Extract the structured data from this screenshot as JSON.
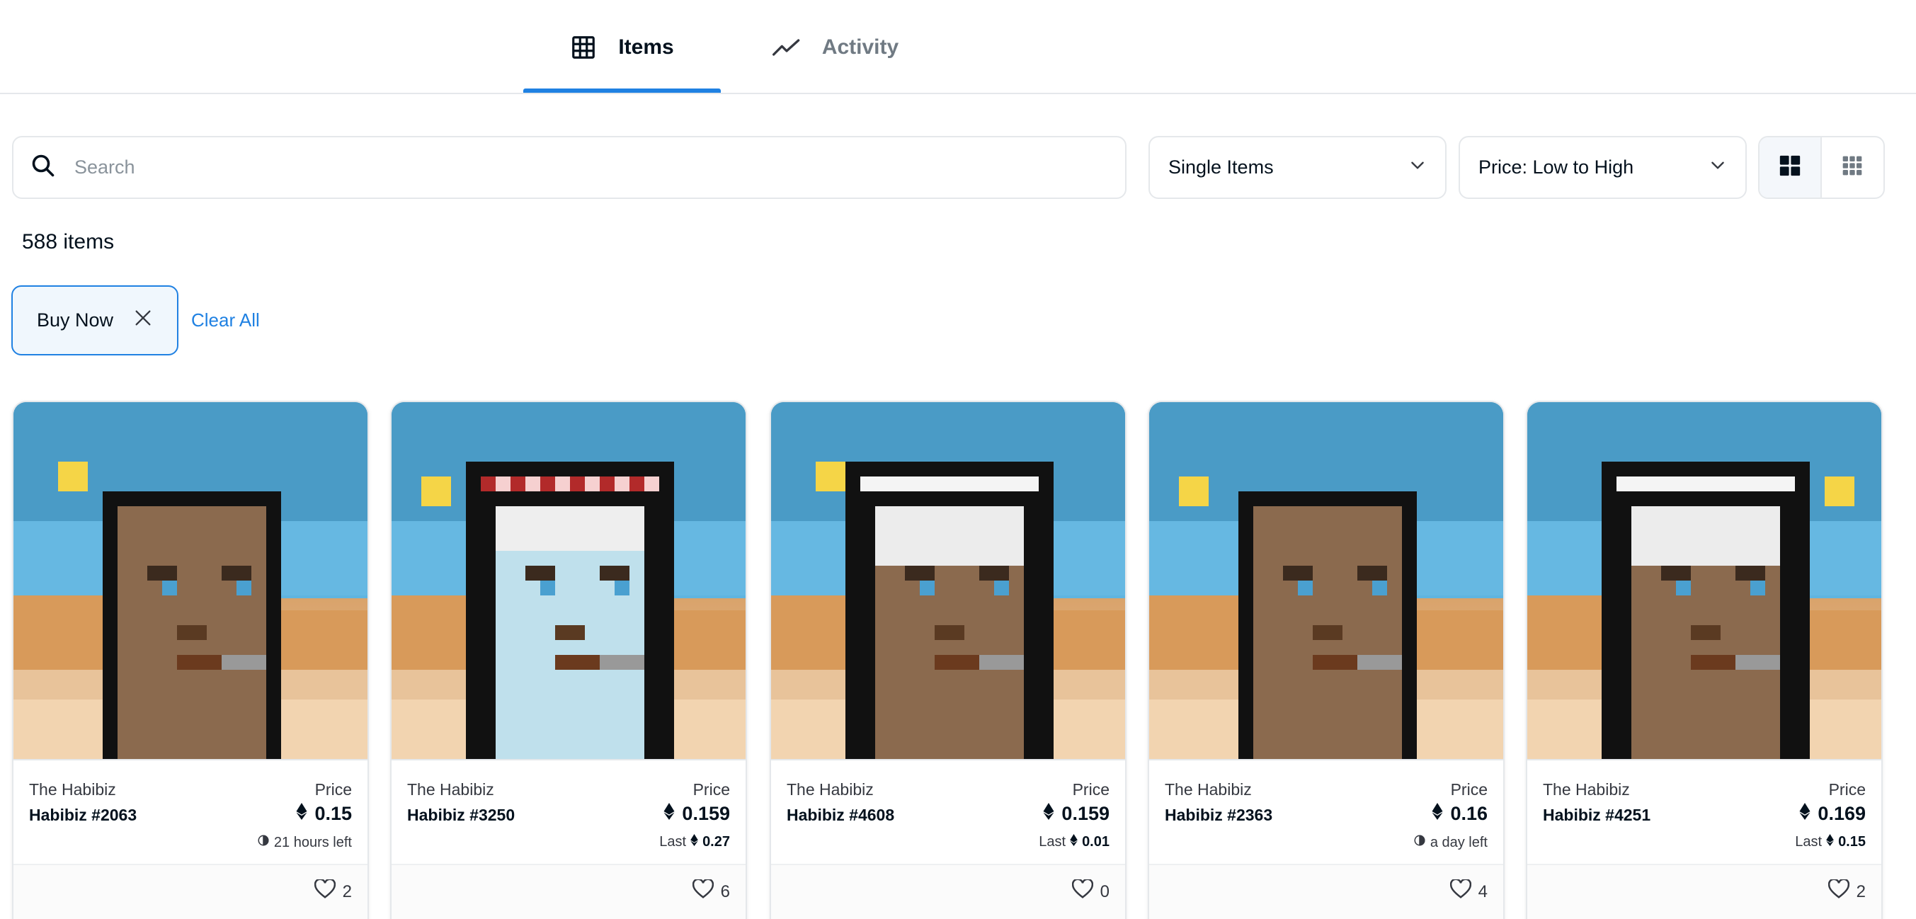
{
  "tabs": [
    {
      "label": "Items",
      "icon": "grid-icon",
      "active": true
    },
    {
      "label": "Activity",
      "icon": "activity-icon",
      "active": false
    }
  ],
  "search": {
    "placeholder": "Search",
    "value": ""
  },
  "filters": {
    "sale_type": "Single Items",
    "sort": "Price: Low to High"
  },
  "view_toggle": {
    "options": [
      "large-grid",
      "small-grid"
    ],
    "selected": "large-grid"
  },
  "results": {
    "count_label": "588 items"
  },
  "active_filters": {
    "chips": [
      "Buy Now"
    ],
    "clear_label": "Clear All"
  },
  "colors": {
    "accent": "#2081e2",
    "text": "#04111d",
    "muted": "#707a83",
    "border": "#e5e8eb"
  },
  "cards": [
    {
      "collection": "The Habibiz",
      "name": "Habibiz #2063",
      "price_label": "Price",
      "price": "0.15",
      "sub_prefix": "",
      "sub_value": "21 hours left",
      "sub_type": "time",
      "likes": "2"
    },
    {
      "collection": "The Habibiz",
      "name": "Habibiz #3250",
      "price_label": "Price",
      "price": "0.159",
      "sub_prefix": "Last",
      "sub_value": "0.27",
      "sub_type": "last",
      "likes": "6"
    },
    {
      "collection": "The Habibiz",
      "name": "Habibiz #4608",
      "price_label": "Price",
      "price": "0.159",
      "sub_prefix": "Last",
      "sub_value": "0.01",
      "sub_type": "last",
      "likes": "0"
    },
    {
      "collection": "The Habibiz",
      "name": "Habibiz #2363",
      "price_label": "Price",
      "price": "0.16",
      "sub_prefix": "",
      "sub_value": "a day left",
      "sub_type": "time",
      "likes": "4"
    },
    {
      "collection": "The Habibiz",
      "name": "Habibiz #4251",
      "price_label": "Price",
      "price": "0.169",
      "sub_prefix": "Last",
      "sub_value": "0.15",
      "sub_type": "last",
      "likes": "2"
    }
  ]
}
